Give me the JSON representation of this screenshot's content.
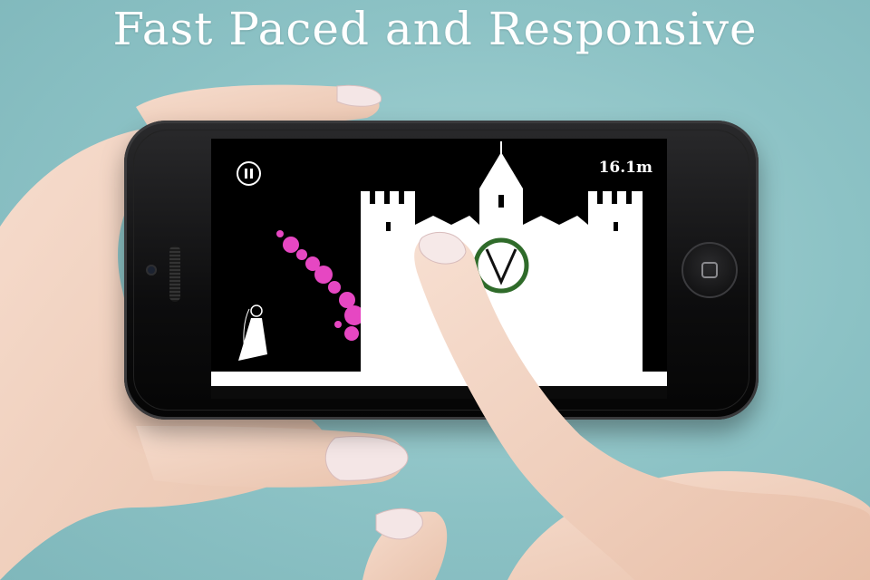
{
  "headline": "Fast Paced and Responsive",
  "game": {
    "distance": "16.1m",
    "pause_icon": "pause-icon",
    "character": "girl-in-white-dress",
    "obstacle": "castle",
    "tap_indicator": "checkmark-circle"
  },
  "colors": {
    "background": "#8fc3c6",
    "phone_body": "#0d0d0e",
    "screen_background": "#000000",
    "castle": "#ffffff",
    "tap_ring": "#2f6b2a",
    "sparkles": "#ff4fd8"
  }
}
